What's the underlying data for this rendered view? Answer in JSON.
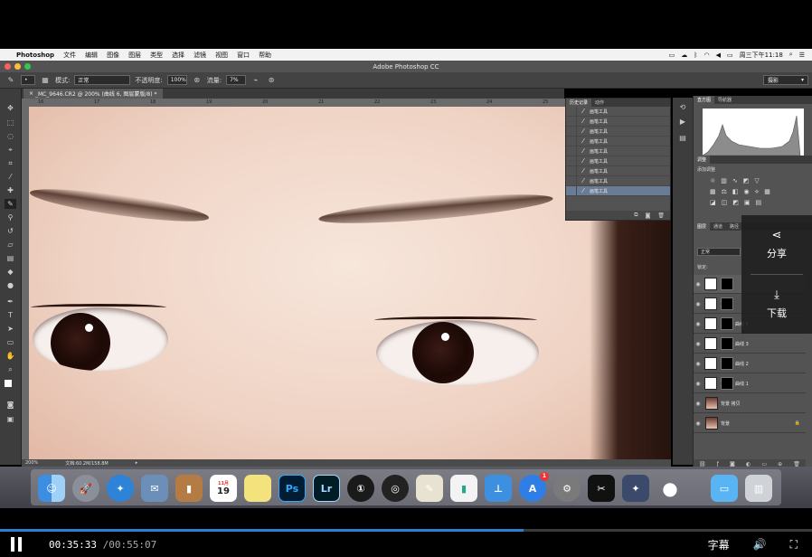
{
  "menubar": {
    "app": "Photoshop",
    "menus": [
      "文件",
      "编辑",
      "图像",
      "图层",
      "类型",
      "选择",
      "滤镜",
      "视图",
      "窗口",
      "帮助"
    ],
    "clock": "周三下午11:18"
  },
  "window": {
    "title": "Adobe Photoshop CC"
  },
  "options": {
    "mode_label": "模式:",
    "mode_value": "正常",
    "opacity_label": "不透明度:",
    "opacity_value": "100%",
    "flow_label": "流量:",
    "flow_value": "7%",
    "workspace": "摄影"
  },
  "document": {
    "tab_title": "_MC_9646.CR2 @ 200% (曲线 6, 图层蒙版/8) *",
    "zoom": "200%",
    "doc_size": "文档:60.2M/158.8M",
    "ruler_marks": [
      "16",
      "17",
      "18",
      "19",
      "20",
      "21",
      "22",
      "23",
      "24",
      "25",
      "26",
      "27"
    ]
  },
  "history_panel": {
    "tabs": [
      "历史记录",
      "动作"
    ],
    "items": [
      "画笔工具",
      "画笔工具",
      "画笔工具",
      "画笔工具",
      "画笔工具",
      "画笔工具",
      "画笔工具",
      "画笔工具",
      "画笔工具"
    ]
  },
  "right_panel": {
    "top_tabs": [
      "直方图",
      "导航器"
    ],
    "adjust_tabs": [
      "调整"
    ],
    "adjust_title": "添加调整",
    "layer_tabs": [
      "图层",
      "通道",
      "路径"
    ],
    "blend_mode": "正常",
    "lock_label": "锁定:",
    "layers": [
      {
        "name": "曲线 4"
      },
      {
        "name": "曲线 3"
      },
      {
        "name": "曲线 2"
      },
      {
        "name": "曲线 1"
      },
      {
        "name": "背景 拷贝"
      },
      {
        "name": "背景"
      }
    ]
  },
  "overlay": {
    "share": "分享",
    "download": "下载"
  },
  "dock": {
    "calendar_day": "19",
    "calendar_month": "11月",
    "ps_label": "Ps",
    "lr_label": "Lr",
    "appstore_badge": "1"
  },
  "player": {
    "current": "00:35:33",
    "total": "/00:55:07",
    "progress": 0.645,
    "subtitle": "字幕"
  }
}
